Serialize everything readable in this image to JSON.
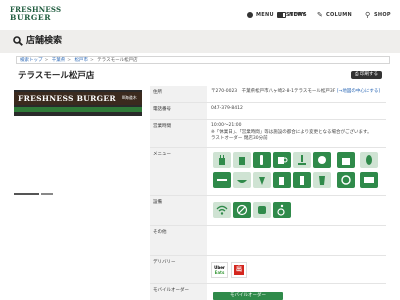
{
  "header": {
    "logo_line1": "FRESHNESS",
    "logo_line2": "BURGER",
    "nav": [
      {
        "label": "MENU",
        "icon": "burger-icon"
      },
      {
        "label": "NEWS",
        "icon": "news-icon"
      },
      {
        "label": "STORY",
        "icon": "book-icon"
      },
      {
        "label": "COLUMN",
        "icon": "pencil-icon"
      },
      {
        "label": "SHOP",
        "icon": "location-pin-icon"
      }
    ]
  },
  "page": {
    "heading": "店舗検索"
  },
  "breadcrumb": [
    {
      "label": "検索トップ",
      "link": true
    },
    {
      "label": "千葉県",
      "link": true
    },
    {
      "label": "松戸市",
      "link": true
    },
    {
      "label": "テラスモール松戸店",
      "link": false
    }
  ],
  "shop": {
    "name": "テラスモール松戸店",
    "print_label": "印刷する",
    "photo_sign": "FRESHNESS BURGER",
    "photo_sign_jp": "Ⅲ海道木"
  },
  "info": {
    "address_label": "住所",
    "address_value": "〒270-0023　千葉県松戸市八ヶ崎2-8-1テラスモール松戸3F",
    "address_link": "[→地図の中心にする]",
    "phone_label": "電話番号",
    "phone_value": "047-379-8412",
    "hours_label": "営業時間",
    "hours_line1": "10:00～21:00",
    "hours_line2": "※「休業日」、「営業時間」等は施設の都合により変更となる場合がございます。",
    "hours_line3": "ラストオーダー 閉店30分前",
    "menu_label": "メニュー",
    "facility_label": "設備",
    "other_label": "その他",
    "delivery_label": "デリバリー",
    "mobile_label": "モバイルオーダー",
    "ubereats_line1": "Uber",
    "ubereats_line2": "Eats",
    "ubereats_caption": "UberEats",
    "demaekan_char": "出",
    "mobile_button": "モバイルオーダー"
  },
  "colors": {
    "brand_green": "#1d5a3c",
    "icon_green": "#2f8a4a",
    "icon_light_green": "#cfe3d3",
    "link_blue": "#2a67b5"
  }
}
